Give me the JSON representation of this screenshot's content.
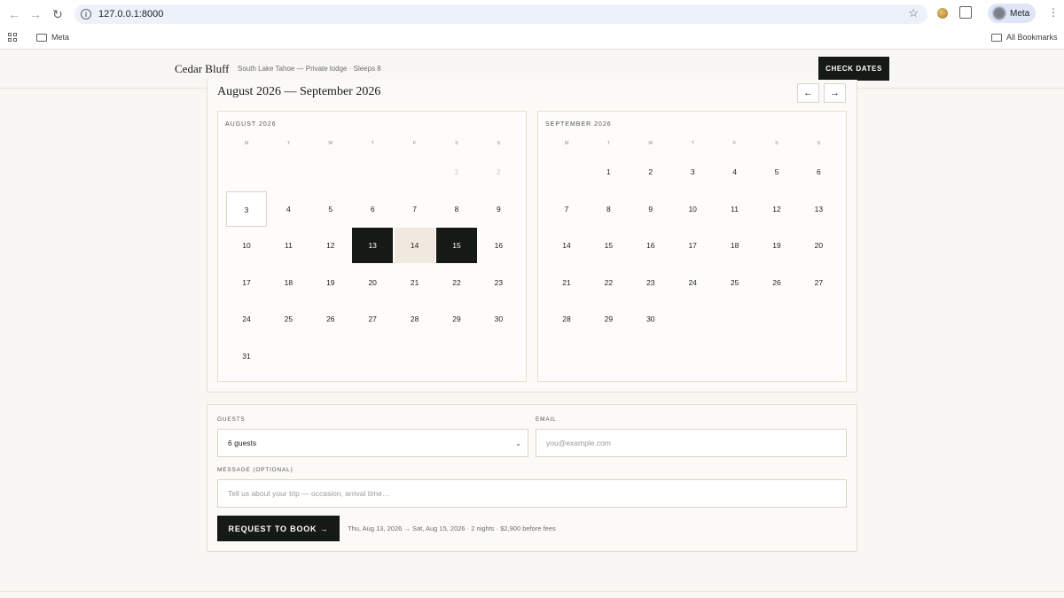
{
  "browser": {
    "url": "127.0.0.1:8000",
    "profile_name": "Meta",
    "bookmark_folder": "Meta",
    "all_bookmarks": "All Bookmarks"
  },
  "header": {
    "brand": "Cedar Bluff",
    "tagline": "South Lake Tahoe — Private lodge · Sleeps 8",
    "check_dates": "CHECK DATES"
  },
  "calendar": {
    "range_title": "August 2026 — September 2026",
    "prev_arrow": "←",
    "next_arrow": "→",
    "weekdays": [
      "M",
      "T",
      "W",
      "T",
      "F",
      "S",
      "S"
    ],
    "months": [
      {
        "name": "AUGUST 2026",
        "rows": [
          [
            "",
            "",
            "",
            "",
            "",
            "1",
            "2"
          ],
          [
            "3",
            "4",
            "5",
            "6",
            "7",
            "8",
            "9"
          ],
          [
            "10",
            "11",
            "12",
            "13",
            "14",
            "15",
            "16"
          ],
          [
            "17",
            "18",
            "19",
            "20",
            "21",
            "22",
            "23"
          ],
          [
            "24",
            "25",
            "26",
            "27",
            "28",
            "29",
            "30"
          ],
          [
            "31",
            "",
            "",
            "",
            "",
            "",
            ""
          ]
        ],
        "dimmed": [
          "1",
          "2"
        ],
        "today": "3",
        "selected": [
          "13",
          "15"
        ],
        "in_range": [
          "14"
        ]
      },
      {
        "name": "SEPTEMBER 2026",
        "rows": [
          [
            "",
            "1",
            "2",
            "3",
            "4",
            "5",
            "6"
          ],
          [
            "7",
            "8",
            "9",
            "10",
            "11",
            "12",
            "13"
          ],
          [
            "14",
            "15",
            "16",
            "17",
            "18",
            "19",
            "20"
          ],
          [
            "21",
            "22",
            "23",
            "24",
            "25",
            "26",
            "27"
          ],
          [
            "28",
            "29",
            "30",
            "",
            "",
            "",
            ""
          ]
        ],
        "dimmed": [],
        "today": "",
        "selected": [],
        "in_range": []
      }
    ]
  },
  "form": {
    "guests_label": "GUESTS",
    "guests_value": "6 guests",
    "email_label": "EMAIL",
    "email_placeholder": "you@example.com",
    "message_label": "MESSAGE (OPTIONAL)",
    "message_placeholder": "Tell us about your trip — occasion, arrival time…",
    "submit_label": "REQUEST TO BOOK →",
    "summary": "Thu, Aug 13, 2026 → Sat, Aug 15, 2026 · 2 nights · $2,900 before fees"
  },
  "colors": {
    "selected": "#151a17",
    "in_range": "#f0e9e0",
    "background": "#f8f7f3"
  }
}
